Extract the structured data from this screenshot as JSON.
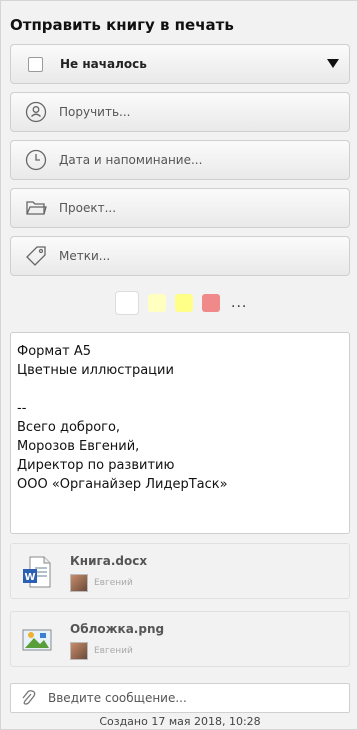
{
  "title": "Отправить книгу в печать",
  "status": {
    "label": "Не началось",
    "icon": "chevron-down-icon"
  },
  "fields": {
    "assign": {
      "label": "Поручить...",
      "icon": "person-icon"
    },
    "date": {
      "label": "Дата и напоминание...",
      "icon": "clock-icon"
    },
    "project": {
      "label": "Проект...",
      "icon": "folder-icon"
    },
    "tags": {
      "label": "Метки...",
      "icon": "tag-icon"
    }
  },
  "colors": {
    "swatches": [
      "#ffffff",
      "#ffffc0",
      "#ffff88",
      "#f08a8a"
    ],
    "more": "..."
  },
  "notes": {
    "lines": [
      "Формат А5",
      "Цветные иллюстрации",
      "",
      "--",
      "Всего доброго,",
      "Морозов Евгений,",
      "Директор по развитию",
      "ООО «Органайзер ЛидерТаск»"
    ]
  },
  "attachments": [
    {
      "name": "Книга.docx",
      "author": "Евгений",
      "icon": "word-file-icon"
    },
    {
      "name": "Обложка.png",
      "author": "Евгений",
      "icon": "image-file-icon"
    }
  ],
  "message": {
    "placeholder": "Введите сообщение...",
    "icon": "paperclip-icon"
  },
  "created": "Создано 17 мая 2018, 10:28"
}
